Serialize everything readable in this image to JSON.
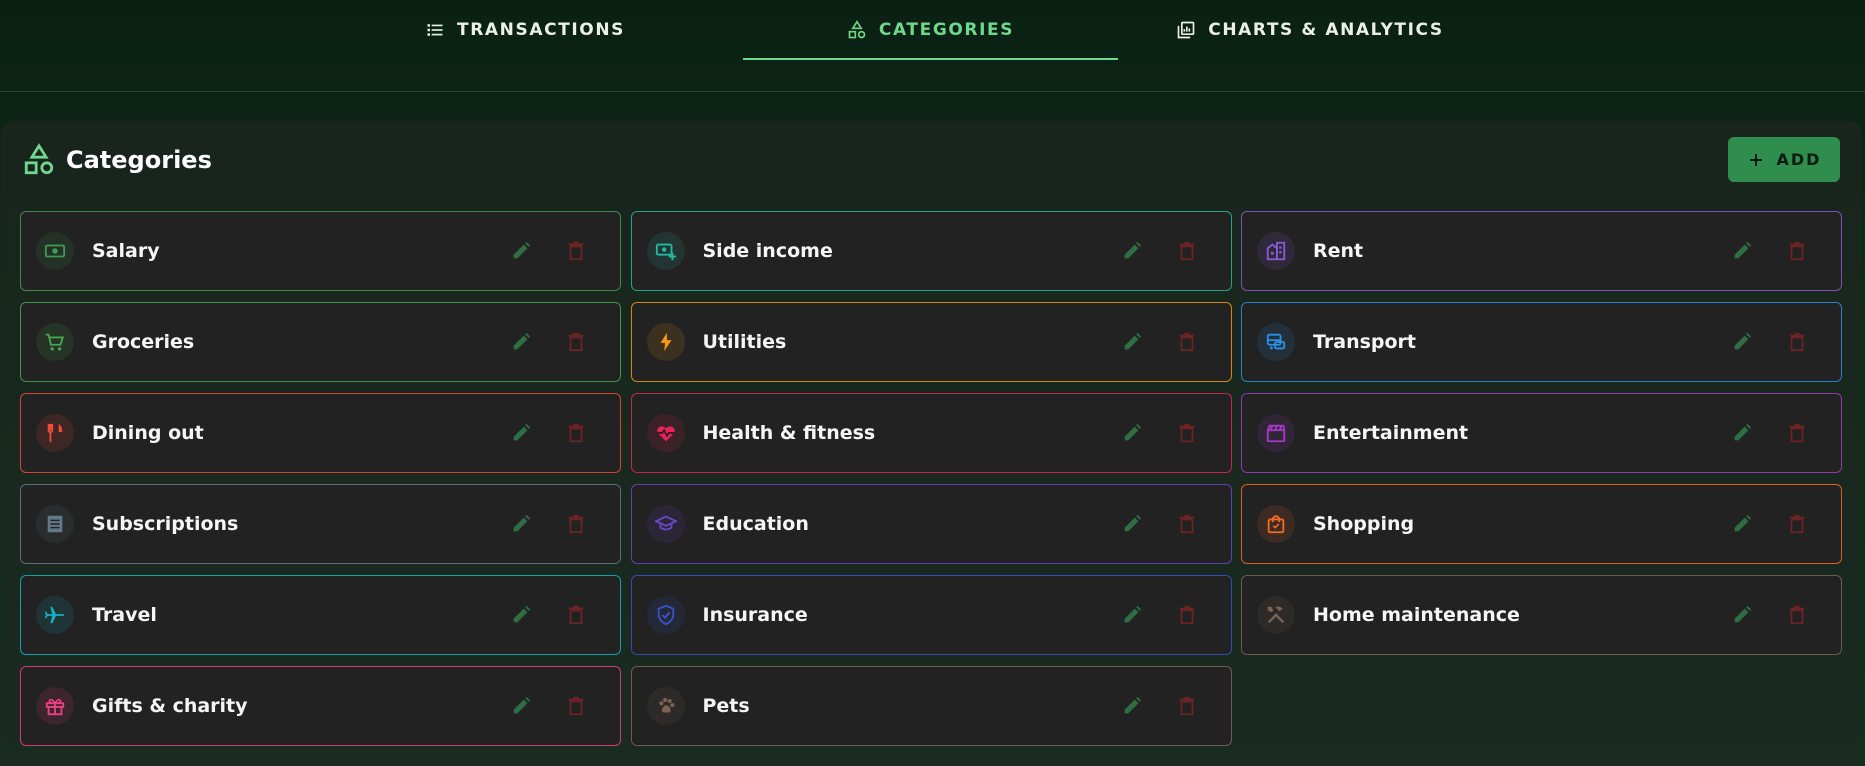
{
  "nav": {
    "tabs": [
      {
        "label": "TRANSACTIONS",
        "icon": "list-icon",
        "active": false
      },
      {
        "label": "CATEGORIES",
        "icon": "shapes-icon",
        "active": true
      },
      {
        "label": "CHARTS & ANALYTICS",
        "icon": "analytics-icon",
        "active": false
      }
    ]
  },
  "panel": {
    "title": "Categories",
    "title_icon": "shapes-icon",
    "add_label": "ADD",
    "add_icon": "plus-icon"
  },
  "colors": {
    "accent": "#6fd88d",
    "add_button": "#2f8e4e",
    "edit_icon": "#2f6e43",
    "delete_icon": "#6b2323"
  },
  "categories": [
    {
      "label": "Salary",
      "icon": "money-icon",
      "color": "#3f9c4e"
    },
    {
      "label": "Side income",
      "icon": "cash-plus-icon",
      "color": "#23b9a0"
    },
    {
      "label": "Rent",
      "icon": "building-icon",
      "color": "#8a5bd6"
    },
    {
      "label": "Groceries",
      "icon": "cart-icon",
      "color": "#44a84f"
    },
    {
      "label": "Utilities",
      "icon": "bolt-icon",
      "color": "#f39a12"
    },
    {
      "label": "Transport",
      "icon": "bus-icon",
      "color": "#2b8fe3"
    },
    {
      "label": "Dining out",
      "icon": "cutlery-icon",
      "color": "#ef4a3a"
    },
    {
      "label": "Health & fitness",
      "icon": "heart-pulse-icon",
      "color": "#e8235a"
    },
    {
      "label": "Entertainment",
      "icon": "clapper-icon",
      "color": "#a63ac6"
    },
    {
      "label": "Subscriptions",
      "icon": "list-box-icon",
      "color": "#627b87"
    },
    {
      "label": "Education",
      "icon": "graduation-cap-icon",
      "color": "#6a46c8"
    },
    {
      "label": "Shopping",
      "icon": "shopping-bag-icon",
      "color": "#f26a24"
    },
    {
      "label": "Travel",
      "icon": "airplane-icon",
      "color": "#13b3c6"
    },
    {
      "label": "Insurance",
      "icon": "shield-check-icon",
      "color": "#3a52c6"
    },
    {
      "label": "Home maintenance",
      "icon": "tools-icon",
      "color": "#7d6256"
    },
    {
      "label": "Gifts & charity",
      "icon": "gift-icon",
      "color": "#ee3f82"
    },
    {
      "label": "Pets",
      "icon": "paw-icon",
      "color": "#816156"
    }
  ]
}
